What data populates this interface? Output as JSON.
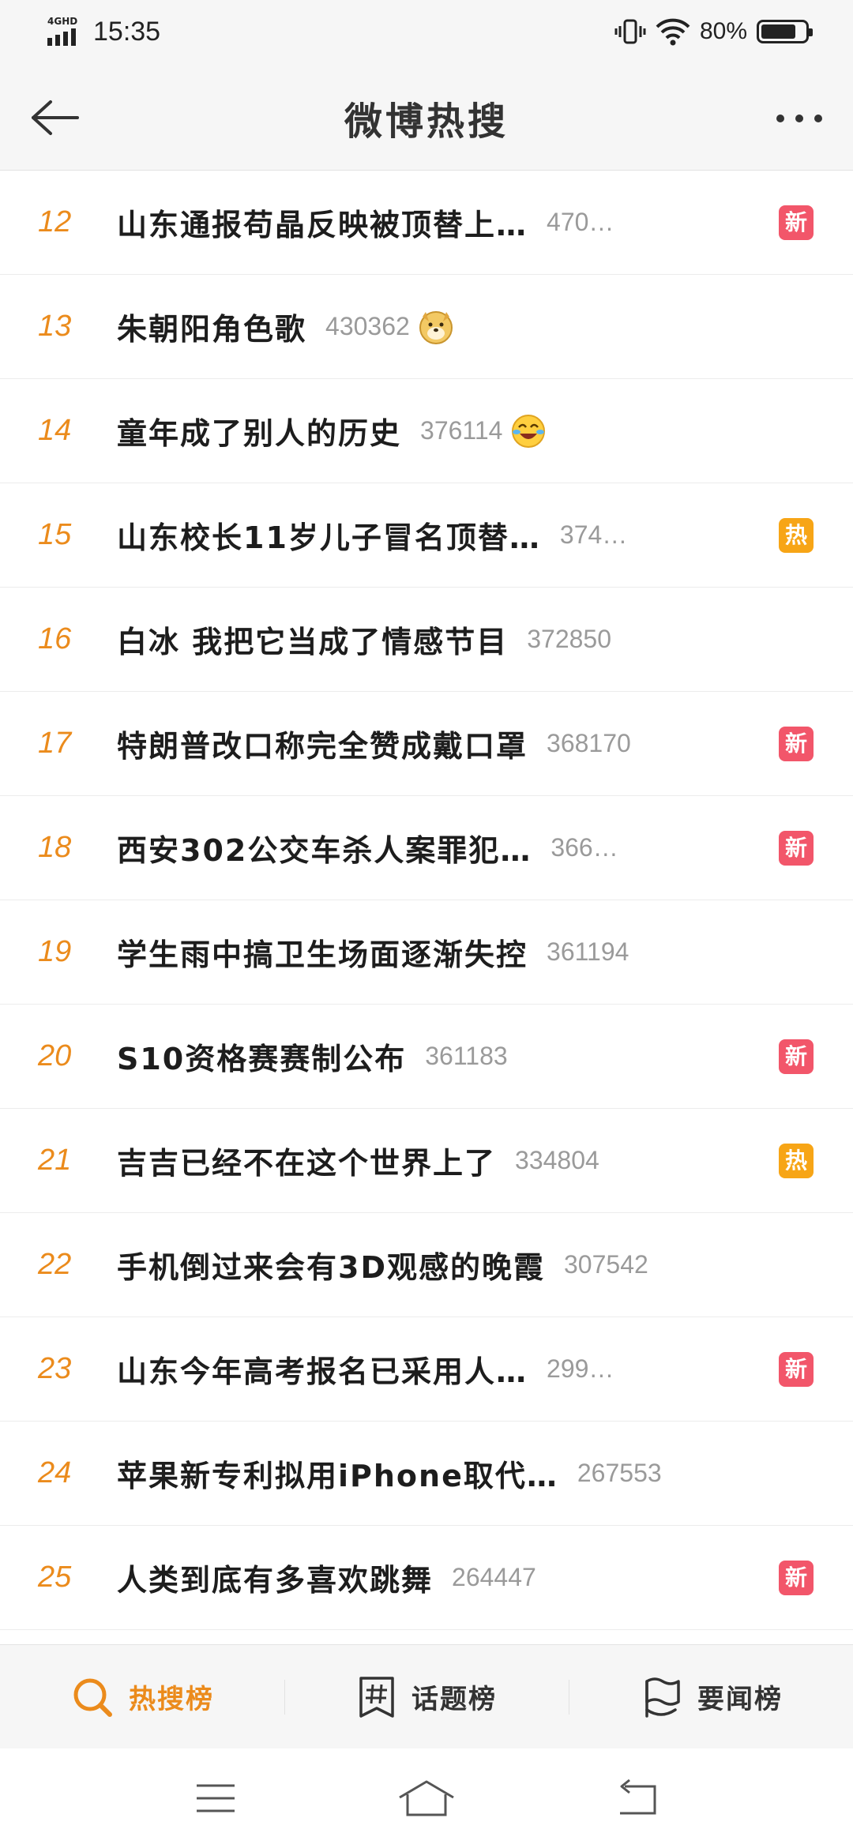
{
  "status_bar": {
    "network": "4GHD",
    "time": "15:35",
    "battery_text": "80%",
    "battery_level": 0.8
  },
  "header": {
    "title": "微博热搜"
  },
  "colors": {
    "rank": "#eb8b1c",
    "badge_new": "#f2566a",
    "badge_hot": "#f7a516",
    "active_tab": "#eb8b1c"
  },
  "list": [
    {
      "rank": "12",
      "title": "山东通报苟晶反映被顶替上…",
      "count": "470…",
      "badge": "新",
      "badge_type": "new",
      "emoji": ""
    },
    {
      "rank": "13",
      "title": "朱朝阳角色歌",
      "count": "430362",
      "badge": "",
      "badge_type": "",
      "emoji": "doge-emoji"
    },
    {
      "rank": "14",
      "title": "童年成了别人的历史",
      "count": "376114",
      "badge": "",
      "badge_type": "",
      "emoji": "laugh-cry-emoji"
    },
    {
      "rank": "15",
      "title": "山东校长11岁儿子冒名顶替…",
      "count": "374…",
      "badge": "热",
      "badge_type": "hot",
      "emoji": ""
    },
    {
      "rank": "16",
      "title": "白冰 我把它当成了情感节目",
      "count": "372850",
      "badge": "",
      "badge_type": "",
      "emoji": ""
    },
    {
      "rank": "17",
      "title": "特朗普改口称完全赞成戴口罩",
      "count": "368170",
      "badge": "新",
      "badge_type": "new",
      "emoji": ""
    },
    {
      "rank": "18",
      "title": "西安302公交车杀人案罪犯…",
      "count": "366…",
      "badge": "新",
      "badge_type": "new",
      "emoji": ""
    },
    {
      "rank": "19",
      "title": "学生雨中搞卫生场面逐渐失控",
      "count": "361194",
      "badge": "",
      "badge_type": "",
      "emoji": ""
    },
    {
      "rank": "20",
      "title": "S10资格赛赛制公布",
      "count": "361183",
      "badge": "新",
      "badge_type": "new",
      "emoji": ""
    },
    {
      "rank": "21",
      "title": "吉吉已经不在这个世界上了",
      "count": "334804",
      "badge": "热",
      "badge_type": "hot",
      "emoji": ""
    },
    {
      "rank": "22",
      "title": "手机倒过来会有3D观感的晚霞",
      "count": "307542",
      "badge": "",
      "badge_type": "",
      "emoji": ""
    },
    {
      "rank": "23",
      "title": "山东今年高考报名已采用人…",
      "count": "299…",
      "badge": "新",
      "badge_type": "new",
      "emoji": ""
    },
    {
      "rank": "24",
      "title": "苹果新专利拟用iPhone取代…",
      "count": "267553",
      "badge": "",
      "badge_type": "",
      "emoji": ""
    },
    {
      "rank": "25",
      "title": "人类到底有多喜欢跳舞",
      "count": "264447",
      "badge": "新",
      "badge_type": "new",
      "emoji": ""
    }
  ],
  "tabs": [
    {
      "label": "热搜榜",
      "icon": "search-magnifier-icon",
      "active": true
    },
    {
      "label": "话题榜",
      "icon": "hashtag-icon",
      "active": false
    },
    {
      "label": "要闻榜",
      "icon": "flag-icon",
      "active": false
    }
  ],
  "nav": [
    {
      "icon": "menu-icon"
    },
    {
      "icon": "home-icon"
    },
    {
      "icon": "back-nav-icon"
    }
  ]
}
